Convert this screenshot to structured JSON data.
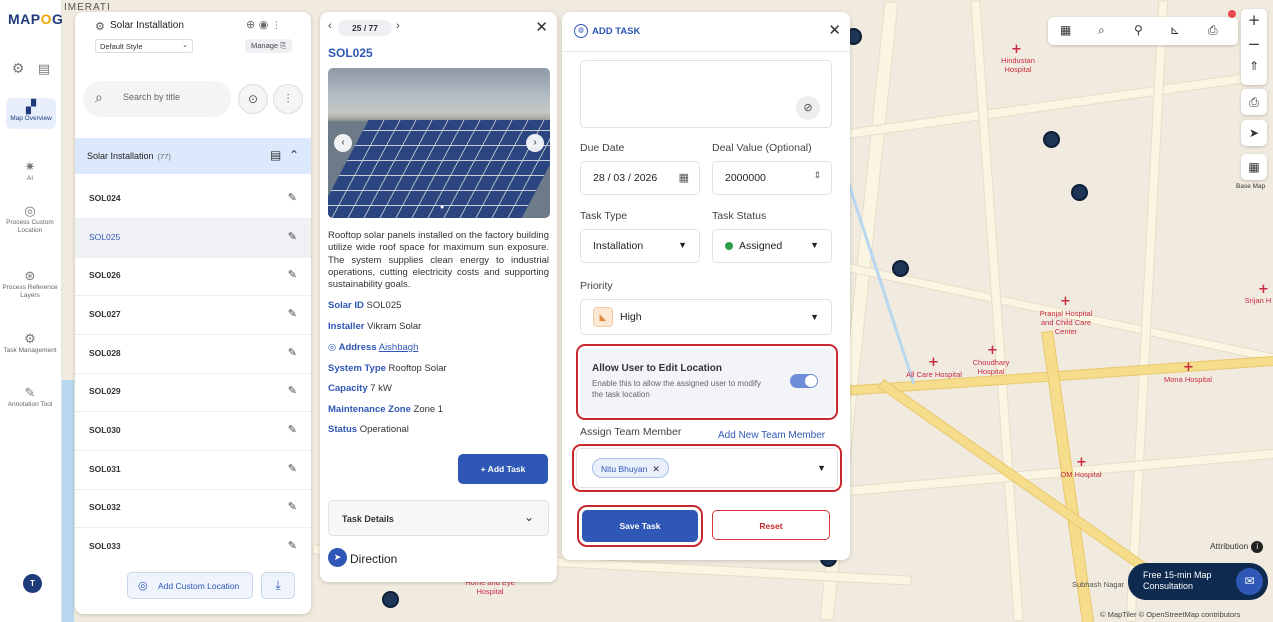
{
  "app": {
    "logo_prefix": "MAP",
    "logo_o": "O",
    "logo_suffix": "G"
  },
  "rail": {
    "items": [
      {
        "label": "Map Overview",
        "icon": "map-icon"
      },
      {
        "label": "AI",
        "icon": "ai-icon"
      },
      {
        "label": "Process Custom Location",
        "icon": "location-pin-icon"
      },
      {
        "label": "Process Reference Layers",
        "icon": "layers-icon"
      },
      {
        "label": "Task Management",
        "icon": "task-icon"
      },
      {
        "label": "Annotation Tool",
        "icon": "annotation-icon"
      }
    ],
    "avatar": "T"
  },
  "layer_panel": {
    "title": "Solar Installation",
    "style_select": "Default Style",
    "manage_label": "Manage",
    "search_placeholder": "Search by title",
    "group_name": "Solar Installation",
    "group_count": "(77)",
    "rows": [
      "SOL024",
      "SOL025",
      "SOL026",
      "SOL027",
      "SOL028",
      "SOL029",
      "SOL030",
      "SOL031",
      "SOL032",
      "SOL033"
    ],
    "selected_row": "SOL025",
    "add_custom_location": "Add Custom Location"
  },
  "detail": {
    "pager": "25 / 77",
    "id": "SOL025",
    "description": "Rooftop solar panels installed on the factory building utilize wide roof space for maximum sun exposure. The system supplies clean energy to industrial operations, cutting electricity costs and supporting sustainability goals.",
    "fields": [
      {
        "label": "Solar ID",
        "value": "SOL025"
      },
      {
        "label": "Installer",
        "value": "Vikram Solar"
      },
      {
        "label": "Address",
        "value": "Aishbagh"
      },
      {
        "label": "System Type",
        "value": "Rooftop Solar"
      },
      {
        "label": "Capacity",
        "value": "7 kW"
      },
      {
        "label": "Maintenance Zone",
        "value": "Zone 1"
      },
      {
        "label": "Status",
        "value": "Operational"
      }
    ],
    "add_task": "+ Add Task",
    "task_details": "Task Details",
    "direction": "Direction"
  },
  "task": {
    "title": "ADD TASK",
    "due_date_label": "Due Date",
    "due_date_value": "28 / 03 / 2026",
    "deal_value_label": "Deal Value (Optional)",
    "deal_value": "2000000",
    "task_type_label": "Task Type",
    "task_type_value": "Installation",
    "task_status_label": "Task Status",
    "task_status_value": "Assigned",
    "priority_label": "Priority",
    "priority_value": "High",
    "allow_edit_title": "Allow User to Edit Location",
    "allow_edit_desc": "Enable this to allow the assigned user to modify the task location",
    "assign_label": "Assign Team Member",
    "add_member": "Add New Team Member",
    "member": "Nitu Bhuyan",
    "save": "Save Task",
    "reset": "Reset",
    "colors": {
      "accent": "#2f57b5",
      "highlight": "#c8282e",
      "status_assigned": "#2e9d4a"
    }
  },
  "map": {
    "labels": {
      "hindustan": "Hindustan Hospital",
      "pranjal": "Pranjal Hospital and Child Care Center",
      "choudhary": "Choudhary Hospital",
      "allcare": "All Care Hospital",
      "mona": "Mona Hospital",
      "om": "OM Hospital",
      "srijan": "Srijan H",
      "subhash": "Subhash Nagar",
      "home": "Home and Eye Hospital",
      "merati": "IMERATI"
    },
    "base_map": "Base Map",
    "attribution": "Attribution",
    "consult": "Free 15-min Map Consultation",
    "copyright": "© MapTiler © OpenStreetMap contributors"
  }
}
